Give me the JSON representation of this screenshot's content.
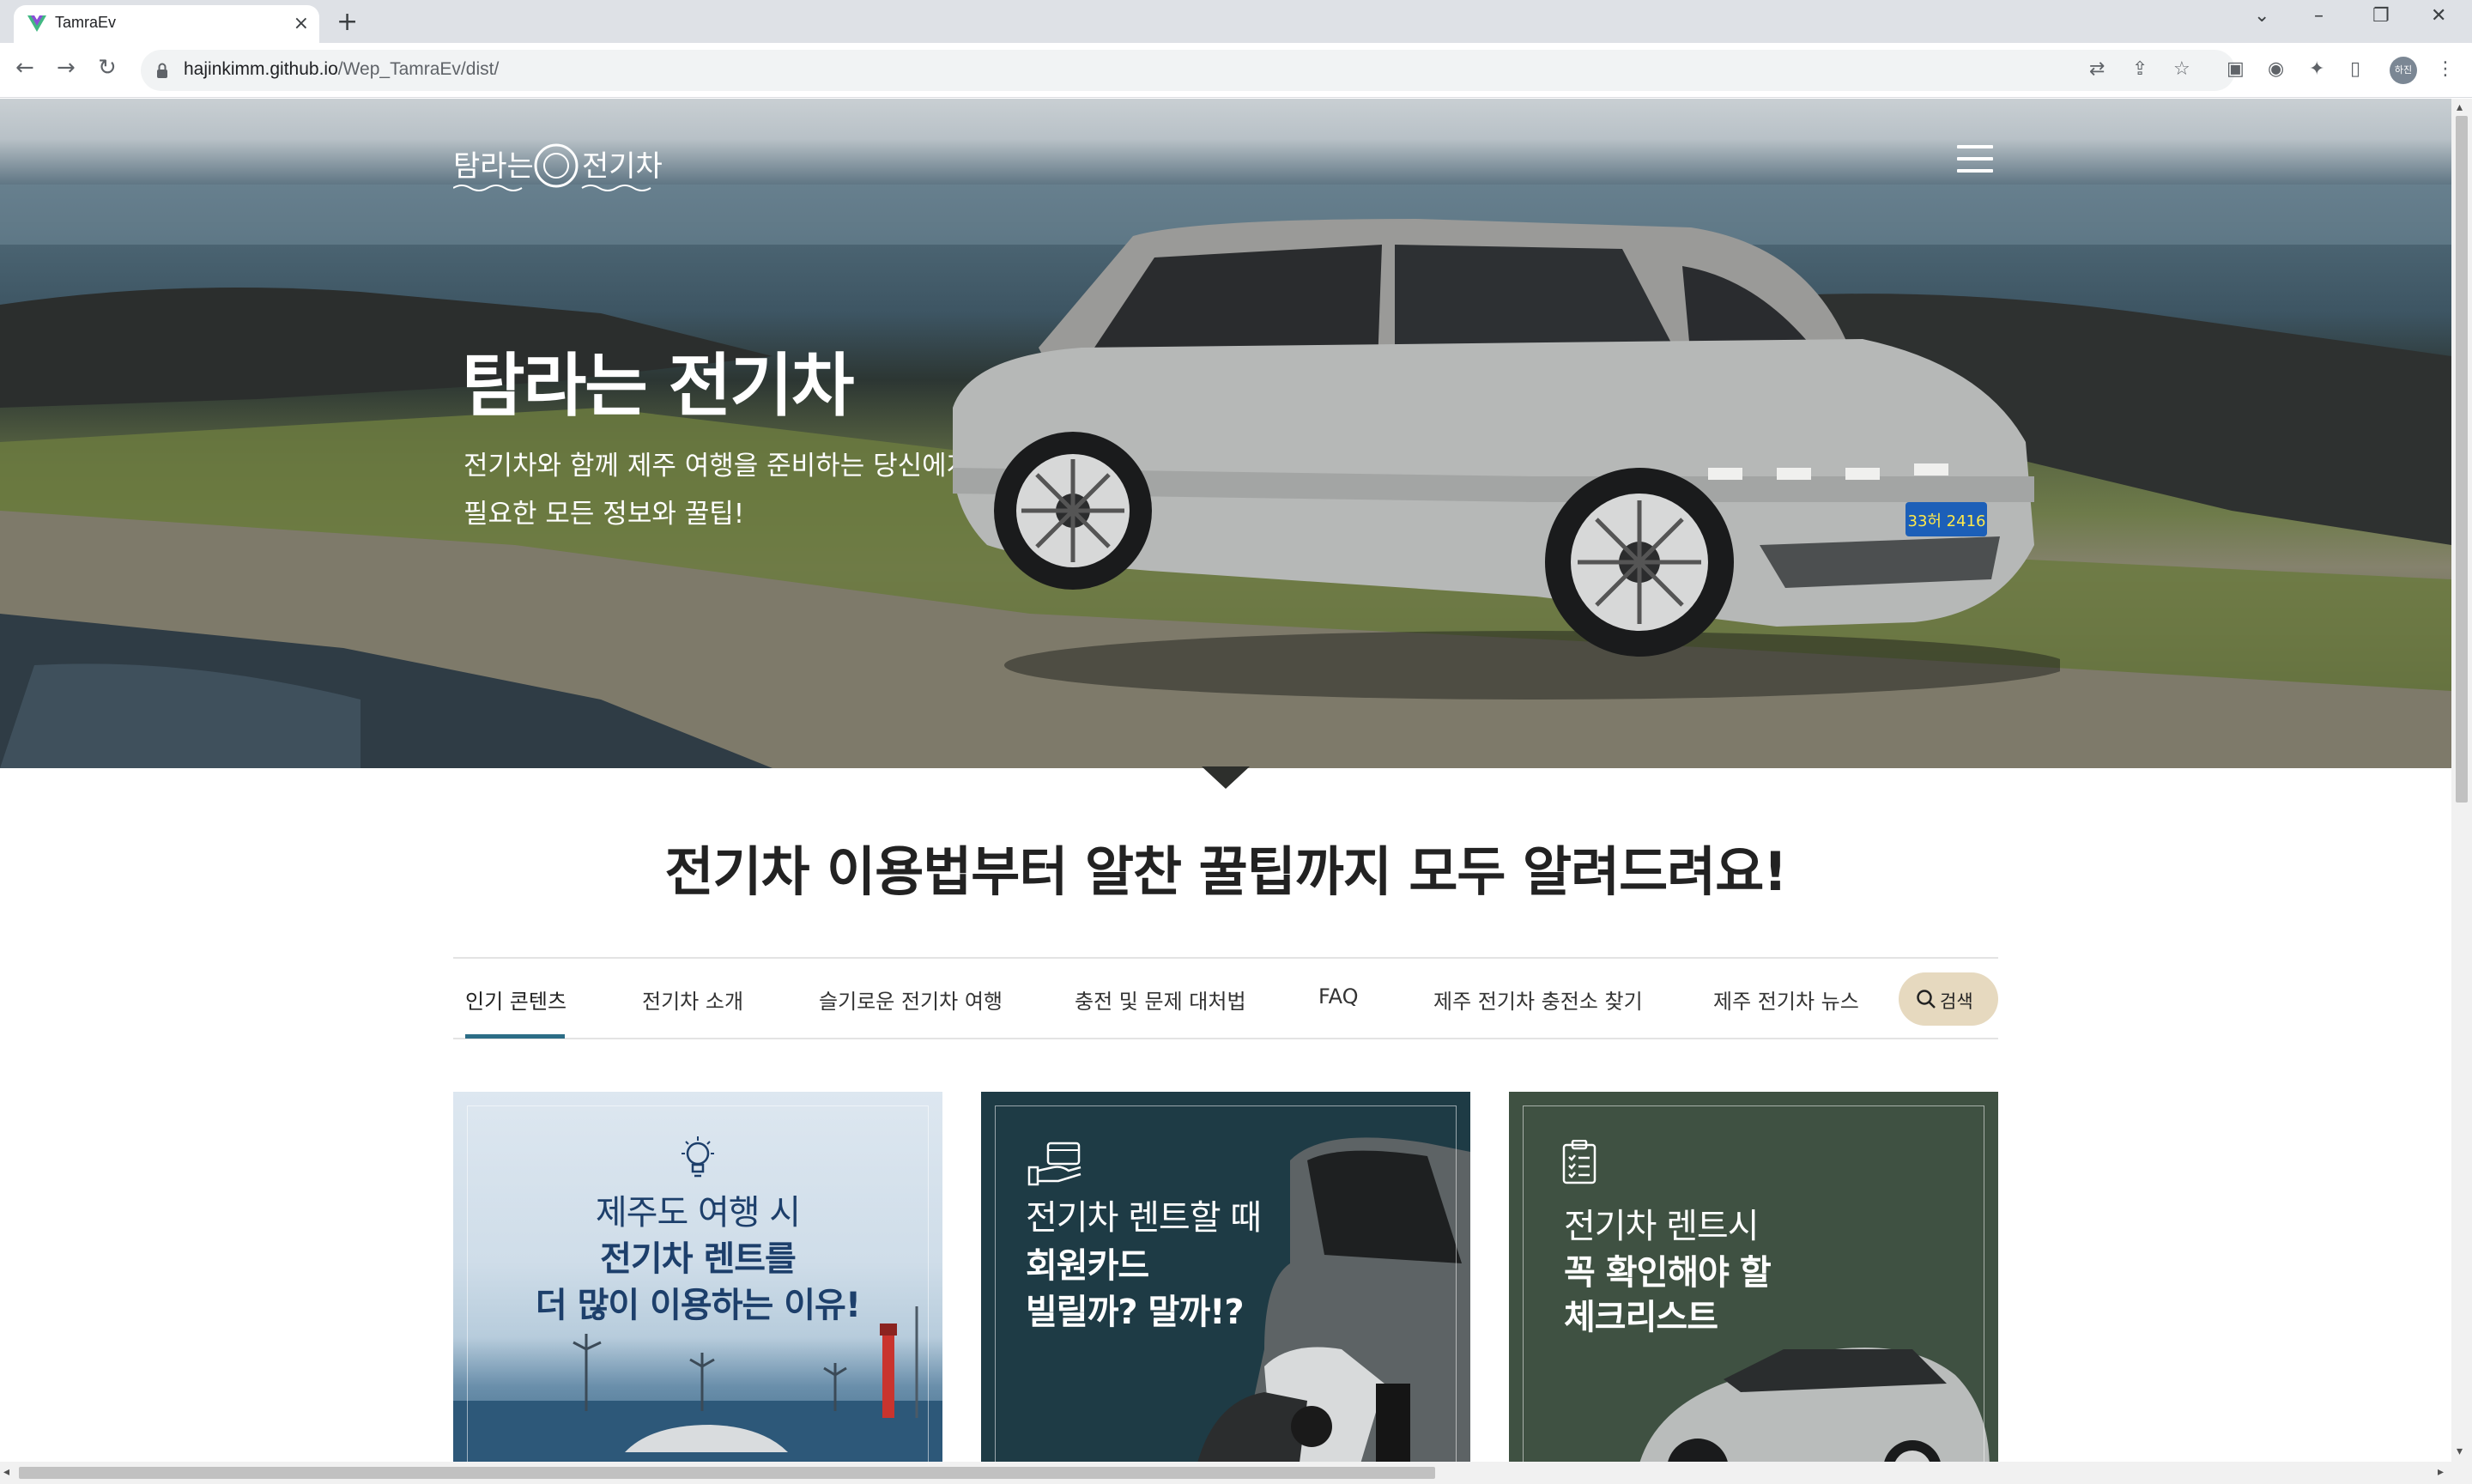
{
  "browser": {
    "tab_title": "TamraEv",
    "url_host": "hajinkimm.github.io",
    "url_path": "/Wep_TamraEv/dist/",
    "profile_label": "하진"
  },
  "hero": {
    "title": "탐라는 전기차",
    "subtitle_line1": "전기차와 함께 제주 여행을 준비하는 당신에게",
    "subtitle_line2": "필요한 모든 정보와 꿀팁!",
    "logo_text": "탐라는 전기차",
    "plate_text": "33허 2416"
  },
  "section": {
    "title": "전기차 이용법부터 알찬 꿀팁까지 모두 알려드려요!"
  },
  "tabs": [
    {
      "label": "인기 콘텐츠",
      "active": true
    },
    {
      "label": "전기차 소개"
    },
    {
      "label": "슬기로운 전기차 여행"
    },
    {
      "label": "충전 및 문제 대처법"
    },
    {
      "label": "FAQ"
    },
    {
      "label": "제주 전기차 충전소 찾기"
    },
    {
      "label": "제주 전기차 뉴스"
    }
  ],
  "search_label": "검색",
  "cards": [
    {
      "icon": "lightbulb-icon",
      "line1": "제주도 여행 시",
      "line2": "전기차 렌트를",
      "line3": "더 많이 이용하는 이유!"
    },
    {
      "icon": "card-hand-icon",
      "line1": "전기차 렌트할 때",
      "line2": "회원카드",
      "line3": "빌릴까? 말까!?"
    },
    {
      "icon": "clipboard-icon",
      "line1": "전기차 렌트시",
      "line2": "꼭 확인해야 할",
      "line3": "체크리스트"
    }
  ],
  "colors": {
    "accent_underline": "#2c6d86",
    "search_button_bg": "#e6d9bf",
    "card2_bg": "#1e3b45",
    "card3_bg": "#3f5142"
  }
}
